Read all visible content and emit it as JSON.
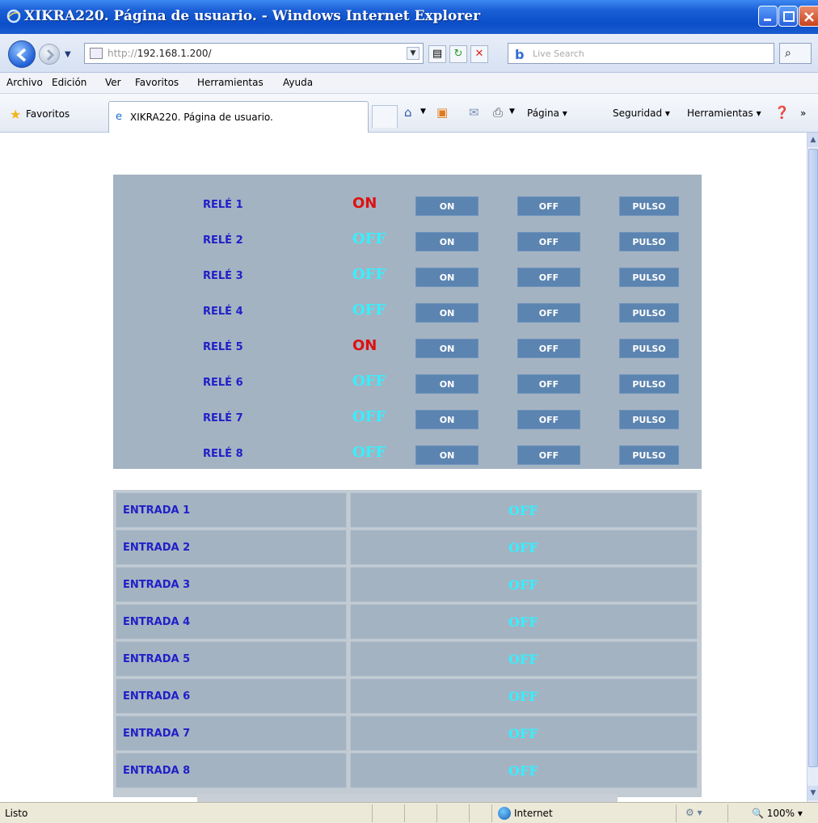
{
  "window": {
    "title": "XIKRA220. Página de usuario. - Windows Internet Explorer"
  },
  "address_bar": {
    "url_proto": "http://",
    "url_host": "192.168.1.200/",
    "search_placeholder": "Live Search"
  },
  "menu": [
    "Archivo",
    "Edición",
    "Ver",
    "Favoritos",
    "Herramientas",
    "Ayuda"
  ],
  "favorites_bar": {
    "favorites_label": "Favoritos",
    "tab_title": "XIKRA220. Página de usuario.",
    "commands": {
      "page": "Página",
      "security": "Seguridad",
      "tools": "Herramientas"
    }
  },
  "relays": [
    {
      "label": "RELÉ 1",
      "state": "ON",
      "on": true
    },
    {
      "label": "RELÉ 2",
      "state": "OFF",
      "on": false
    },
    {
      "label": "RELÉ 3",
      "state": "OFF",
      "on": false
    },
    {
      "label": "RELÉ 4",
      "state": "OFF",
      "on": false
    },
    {
      "label": "RELÉ 5",
      "state": "ON",
      "on": true
    },
    {
      "label": "RELÉ 6",
      "state": "OFF",
      "on": false
    },
    {
      "label": "RELÉ 7",
      "state": "OFF",
      "on": false
    },
    {
      "label": "RELÉ 8",
      "state": "OFF",
      "on": false
    }
  ],
  "relay_buttons": {
    "on": "ON",
    "off": "OFF",
    "pulse": "PULSO"
  },
  "inputs": [
    {
      "label": "ENTRADA 1",
      "state": "OFF"
    },
    {
      "label": "ENTRADA 2",
      "state": "OFF"
    },
    {
      "label": "ENTRADA 3",
      "state": "OFF"
    },
    {
      "label": "ENTRADA 4",
      "state": "OFF"
    },
    {
      "label": "ENTRADA 5",
      "state": "OFF"
    },
    {
      "label": "ENTRADA 6",
      "state": "OFF"
    },
    {
      "label": "ENTRADA 7",
      "state": "OFF"
    },
    {
      "label": "ENTRADA 8",
      "state": "OFF"
    }
  ],
  "status_bar": {
    "status": "Listo",
    "zone": "Internet",
    "zoom": "100%"
  },
  "colors": {
    "panel_bg": "#a4b3c2",
    "label_blue": "#2020c8",
    "state_on": "#dd1111",
    "state_off": "#35f0ff",
    "button_bg": "#5c84b0"
  }
}
